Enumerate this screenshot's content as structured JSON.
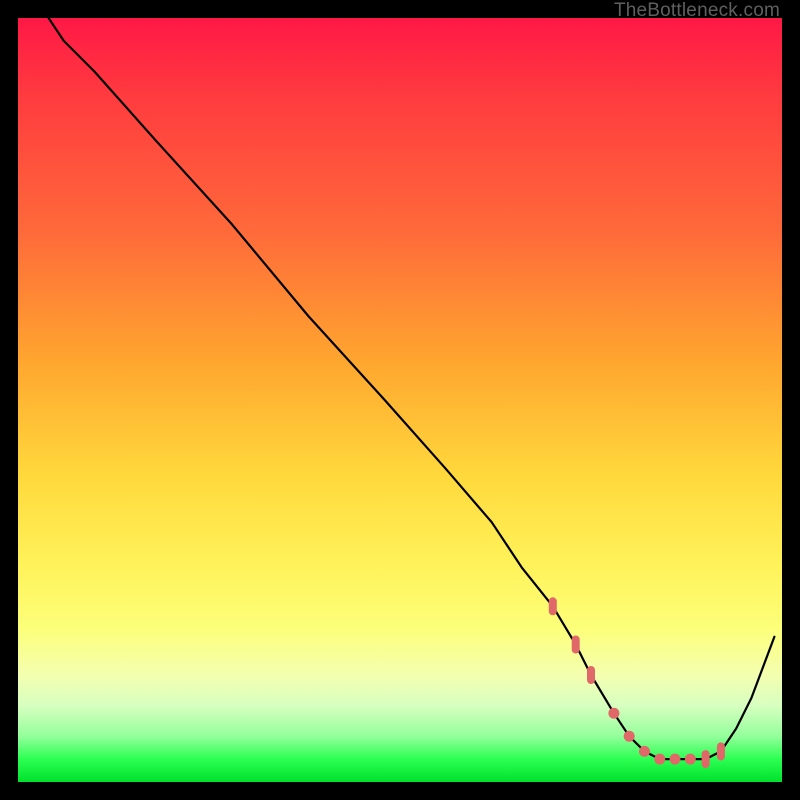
{
  "watermark": "TheBottleneck.com",
  "chart_data": {
    "type": "line",
    "title": "",
    "xlabel": "",
    "ylabel": "",
    "xlim": [
      0,
      100
    ],
    "ylim": [
      0,
      100
    ],
    "series": [
      {
        "name": "bottleneck-curve",
        "x": [
          4,
          6,
          10,
          18,
          28,
          38,
          48,
          56,
          62,
          66,
          70,
          73,
          75,
          78,
          80,
          82,
          84,
          86,
          88,
          90,
          92,
          94,
          96,
          99
        ],
        "values": [
          100,
          97,
          93,
          84,
          73,
          61,
          50,
          41,
          34,
          28,
          23,
          18,
          14,
          9,
          6,
          4,
          3,
          3,
          3,
          3,
          4,
          7,
          11,
          19
        ]
      }
    ],
    "highlight": {
      "name": "optimal-region",
      "x": [
        70,
        73,
        75,
        78,
        80,
        82,
        84,
        86,
        88,
        90,
        92
      ],
      "values": [
        23,
        18,
        14,
        9,
        6,
        4,
        3,
        3,
        3,
        3,
        4
      ]
    },
    "colors": {
      "gradient_top": "#ff1846",
      "gradient_mid": "#fff35b",
      "gradient_bottom": "#00e12c",
      "curve": "#000000",
      "dots": "#e06868"
    }
  }
}
